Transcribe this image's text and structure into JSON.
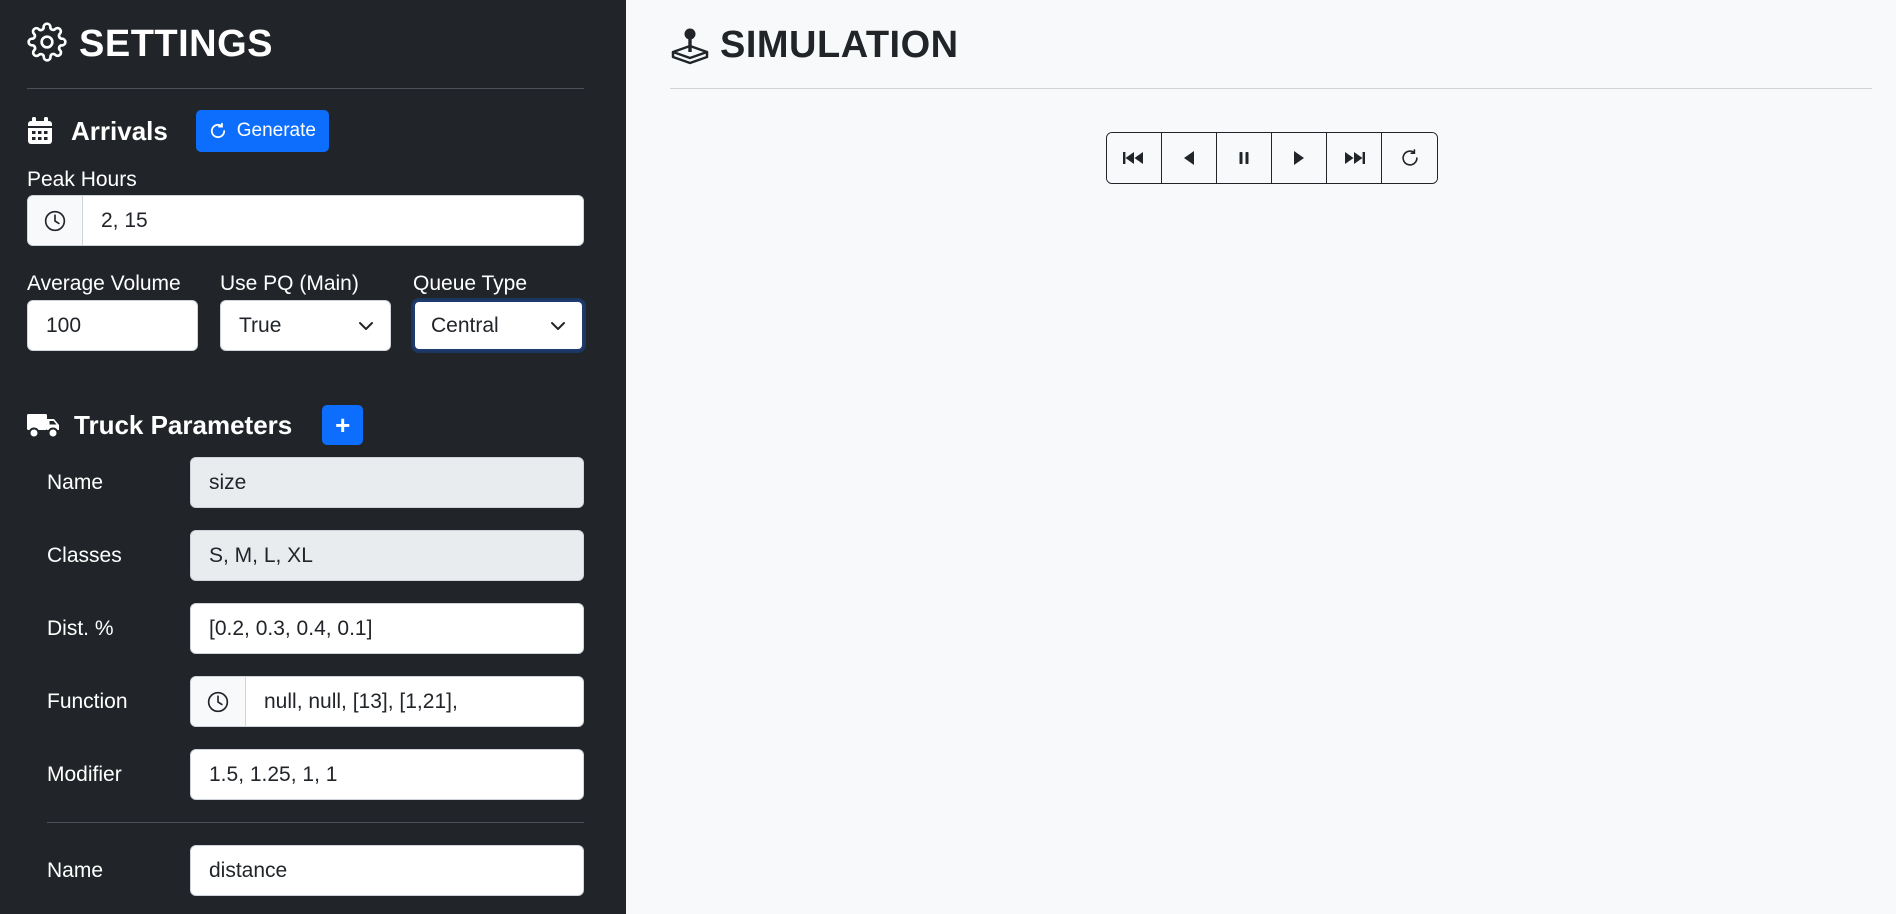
{
  "sidebar": {
    "title": "SETTINGS",
    "arrivals": {
      "title": "Arrivals",
      "generate_label": "Generate",
      "peak_hours_label": "Peak Hours",
      "peak_hours_value": "2, 15",
      "avg_volume_label": "Average Volume",
      "avg_volume_value": "100",
      "use_pq_label": "Use PQ (Main)",
      "use_pq_value": "True",
      "queue_type_label": "Queue Type",
      "queue_type_value": "Central"
    },
    "truck_params": {
      "title": "Truck Parameters",
      "add_label": "+",
      "rows": [
        {
          "label": "Name",
          "value": "size"
        },
        {
          "label": "Classes",
          "value": "S, M, L, XL"
        },
        {
          "label": "Dist. %",
          "value": "[0.2, 0.3, 0.4, 0.1]"
        },
        {
          "label": "Function",
          "value": "null, null, [13], [1,21],"
        },
        {
          "label": "Modifier",
          "value": "1.5, 1.25, 1, 1"
        },
        {
          "label": "Name",
          "value": "distance"
        }
      ]
    }
  },
  "main": {
    "title": "SIMULATION",
    "controls": [
      "skip-back",
      "step-back",
      "pause",
      "step-forward",
      "skip-forward",
      "reset"
    ]
  },
  "colors": {
    "sidebar_bg": "#212529",
    "main_bg": "#f8f9fa",
    "accent": "#0d6efd"
  }
}
